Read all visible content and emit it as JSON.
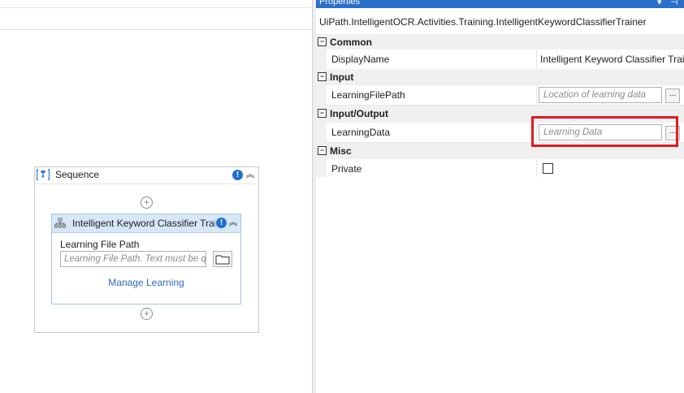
{
  "designer": {
    "sequence": {
      "title": "Sequence"
    },
    "activity": {
      "title": "Intelligent Keyword Classifier Trainer",
      "field_label": "Learning File Path",
      "field_placeholder": "Learning File Path. Text must be quoted",
      "manage_link": "Manage Learning"
    }
  },
  "properties": {
    "panel_title": "Properties",
    "class_name": "UiPath.IntelligentOCR.Activities.Training.IntelligentKeywordClassifierTrainer",
    "categories": [
      {
        "label": "Common",
        "toggle": "−",
        "props": [
          {
            "name": "DisplayName",
            "value": "Intelligent Keyword Classifier Trainer"
          }
        ]
      },
      {
        "label": "Input",
        "toggle": "−",
        "props": [
          {
            "name": "LearningFilePath",
            "placeholder": "Location of learning data",
            "button": "..."
          }
        ]
      },
      {
        "label": "Input/Output",
        "toggle": "−",
        "props": [
          {
            "name": "LearningData",
            "placeholder": "Learning Data",
            "button": "..."
          }
        ]
      },
      {
        "label": "Misc",
        "toggle": "−",
        "props": [
          {
            "name": "Private",
            "checked": false
          }
        ]
      }
    ]
  },
  "colors": {
    "accent": "#2a6fc9",
    "highlight": "#e01b24",
    "activity_header": "#d6e7f7",
    "link": "#2a6ab8"
  }
}
